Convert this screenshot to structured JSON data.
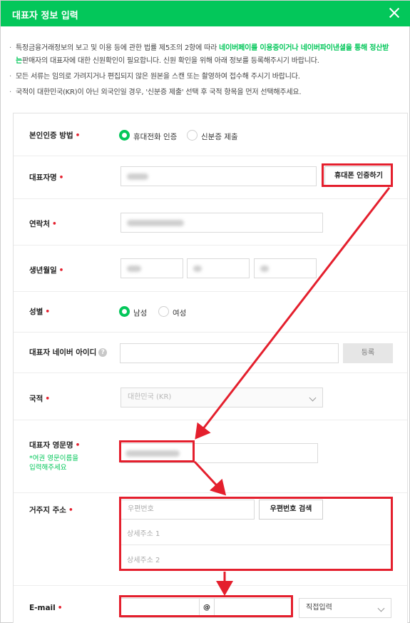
{
  "window": {
    "title": "대표자 정보 입력"
  },
  "notices": {
    "n1_pre": "특정금융거래정보의 보고 및 이용 등에 관한 법률 제5조의 2항에 따라 ",
    "n1_green1": "네이버페이를 이용중이거나 네이버파이낸셜을 통해 정산받",
    "n1_green2": "는",
    "n1_post": "판매자의 대표자에 대한 신원확인이 필요합니다. 신원 확인을 위해 아래 정보를 등록해주시기 바랍니다.",
    "n2": "모든 서류는 임의로 가려지거나 편집되지 않은 원본을 스캔 또는 촬영하여 접수해 주시기 바랍니다.",
    "n3": "국적이 대한민국(KR)이 아닌 외국인일 경우, '신분증 제출' 선택 후 국적 항목을 먼저 선택해주세요."
  },
  "form": {
    "auth_method": {
      "label": "본인인증 방법",
      "required": "•",
      "options": [
        "휴대전화 인증",
        "신분증 제출"
      ],
      "selected": 0
    },
    "name": {
      "label": "대표자명",
      "required": "•",
      "verify_button": "휴대폰 인증하기"
    },
    "phone": {
      "label": "연락처",
      "required": "•"
    },
    "birth": {
      "label": "생년월일",
      "required": "•"
    },
    "gender": {
      "label": "성별",
      "required": "•",
      "options": [
        "남성",
        "여성"
      ],
      "selected": 0
    },
    "naver_id": {
      "label": "대표자 네이버 아이디",
      "help": "?",
      "register_button": "등록"
    },
    "nationality": {
      "label": "국적",
      "required": "•",
      "value": "대한민국 (KR)"
    },
    "english_name": {
      "label": "대표자 영문명",
      "required": "•",
      "hint_line1": "*여권 영문이름을",
      "hint_line2": "입력해주세요"
    },
    "address": {
      "label": "거주지 주소",
      "required": "•",
      "zip_placeholder": "우편번호",
      "zip_search_button": "우편번호 검색",
      "addr1_placeholder": "상세주소 1",
      "addr2_placeholder": "상세주소 2"
    },
    "email": {
      "label": "E-mail",
      "required": "•",
      "at": "@",
      "domain_select": "직접입력"
    }
  },
  "colors": {
    "brand_green": "#03c75a",
    "annotation_red": "#e41f2d"
  }
}
